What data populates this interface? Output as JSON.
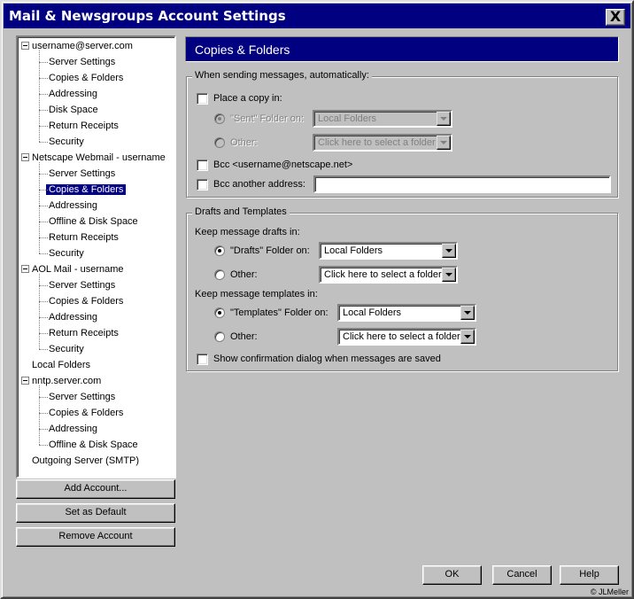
{
  "window": {
    "title": "Mail & Newsgroups Account Settings",
    "close_label": "X"
  },
  "tree": [
    {
      "label": "username@server.com",
      "level": 0,
      "expander": true
    },
    {
      "label": "Server Settings",
      "level": 1
    },
    {
      "label": "Copies & Folders",
      "level": 1
    },
    {
      "label": "Addressing",
      "level": 1
    },
    {
      "label": "Disk Space",
      "level": 1
    },
    {
      "label": "Return Receipts",
      "level": 1
    },
    {
      "label": "Security",
      "level": 1
    },
    {
      "label": "Netscape Webmail - username",
      "level": 0,
      "expander": true
    },
    {
      "label": "Server Settings",
      "level": 1
    },
    {
      "label": "Copies & Folders",
      "level": 1,
      "selected": true
    },
    {
      "label": "Addressing",
      "level": 1
    },
    {
      "label": "Offline & Disk Space",
      "level": 1
    },
    {
      "label": "Return Receipts",
      "level": 1
    },
    {
      "label": "Security",
      "level": 1
    },
    {
      "label": "AOL Mail - username",
      "level": 0,
      "expander": true
    },
    {
      "label": "Server Settings",
      "level": 1
    },
    {
      "label": "Copies & Folders",
      "level": 1
    },
    {
      "label": "Addressing",
      "level": 1
    },
    {
      "label": "Return Receipts",
      "level": 1
    },
    {
      "label": "Security",
      "level": 1
    },
    {
      "label": "Local Folders",
      "level": 0,
      "expander": false
    },
    {
      "label": "nntp.server.com",
      "level": 0,
      "expander": true
    },
    {
      "label": "Server Settings",
      "level": 1
    },
    {
      "label": "Copies & Folders",
      "level": 1
    },
    {
      "label": "Addressing",
      "level": 1
    },
    {
      "label": "Offline & Disk Space",
      "level": 1
    },
    {
      "label": "Outgoing Server (SMTP)",
      "level": 0,
      "expander": false
    }
  ],
  "left_buttons": {
    "add_account": "Add Account...",
    "set_default": "Set as Default",
    "remove_account": "Remove Account"
  },
  "panel": {
    "title": "Copies & Folders",
    "sending": {
      "legend": "When sending messages, automatically:",
      "place_copy": "Place a copy in:",
      "sent_folder_label": "\"Sent\" Folder on:",
      "sent_folder_value": "Local Folders",
      "other_label": "Other:",
      "other_value": "Click here to select a folder",
      "bcc_self": "Bcc <username@netscape.net>",
      "bcc_other": "Bcc another address:",
      "bcc_other_value": ""
    },
    "drafts": {
      "legend": "Drafts and Templates",
      "keep_drafts": "Keep message drafts in:",
      "drafts_folder_label": "\"Drafts\" Folder on:",
      "drafts_folder_value": "Local Folders",
      "drafts_other_label": "Other:",
      "drafts_other_value": "Click here to select a folder",
      "keep_templates": "Keep message templates in:",
      "templates_folder_label": "\"Templates\" Folder on:",
      "templates_folder_value": "Local Folders",
      "templates_other_label": "Other:",
      "templates_other_value": "Click here to select a folder",
      "confirm_dialog": "Show confirmation dialog when messages are saved"
    }
  },
  "footer": {
    "ok": "OK",
    "cancel": "Cancel",
    "help": "Help",
    "copyright": "© JLMeller"
  }
}
